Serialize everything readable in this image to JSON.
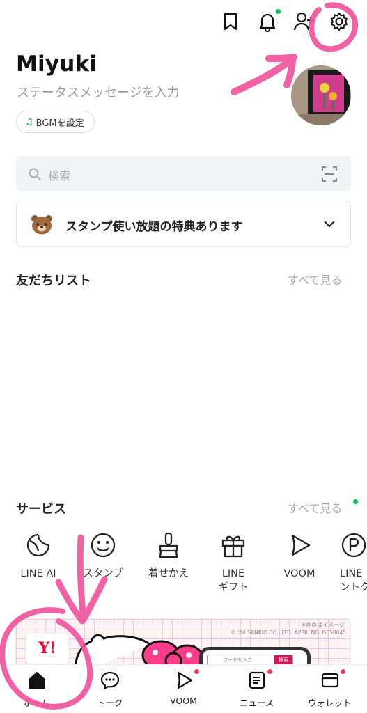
{
  "header": {
    "icons": [
      "bookmark-icon",
      "bell-icon",
      "add-friend-icon",
      "gear-icon"
    ]
  },
  "profile": {
    "name": "Miyuki",
    "status_placeholder": "ステータスメッセージを入力",
    "bgm_label": "BGMを設定"
  },
  "search": {
    "placeholder": "検索"
  },
  "promo": {
    "text": "スタンプ使い放題の特典あります"
  },
  "friends": {
    "title": "友だちリスト",
    "see_all": "すべて見る"
  },
  "services": {
    "title": "サービス",
    "see_all": "すべて見る",
    "items": [
      {
        "label": "LINE AI",
        "icon": "line-ai-icon"
      },
      {
        "label": "スタンプ",
        "icon": "smiley-icon"
      },
      {
        "label": "着せかえ",
        "icon": "brush-icon"
      },
      {
        "label": "LINE\nギフト",
        "icon": "gift-icon"
      },
      {
        "label": "VOOM",
        "icon": "voom-icon"
      },
      {
        "label": "LINE\nントク",
        "icon": "point-icon"
      }
    ]
  },
  "banner": {
    "note": "※画面はイメージ",
    "copyright": "© '24 SANRIO CO., LTD. APPR. NO. G650045",
    "logo_text": "Y!",
    "search_placeholder": "ワードを入力",
    "search_button": "検索"
  },
  "tabs": [
    {
      "label": "ホーム",
      "icon": "home-icon",
      "active": true
    },
    {
      "label": "トーク",
      "icon": "chat-icon"
    },
    {
      "label": "VOOM",
      "icon": "voom-tab-icon"
    },
    {
      "label": "ニュース",
      "icon": "news-icon"
    },
    {
      "label": "ウォレット",
      "icon": "wallet-icon"
    }
  ],
  "colors": {
    "accent": "#06c755",
    "badge": "#ff3b58",
    "annotation": "#f0529c"
  }
}
